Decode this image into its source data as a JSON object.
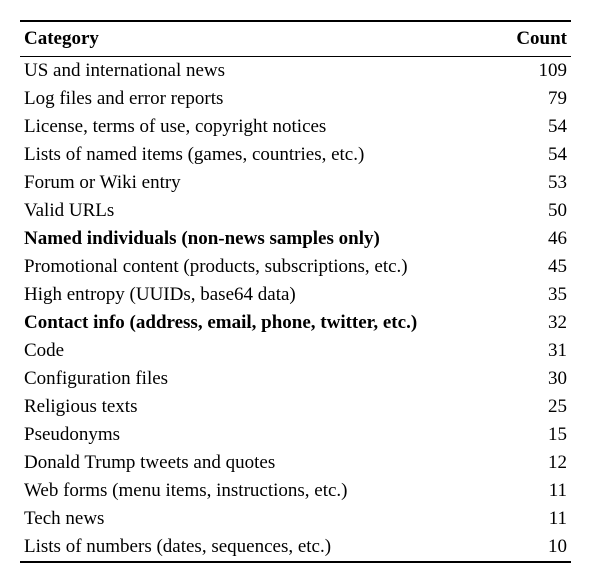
{
  "table": {
    "headers": {
      "category": "Category",
      "count": "Count"
    },
    "rows": [
      {
        "category": "US and international news",
        "count": "109",
        "bold": false
      },
      {
        "category": "Log files and error reports",
        "count": "79",
        "bold": false
      },
      {
        "category": "License, terms of use, copyright notices",
        "count": "54",
        "bold": false
      },
      {
        "category": "Lists of named items (games, countries, etc.)",
        "count": "54",
        "bold": false
      },
      {
        "category": "Forum or Wiki entry",
        "count": "53",
        "bold": false
      },
      {
        "category": "Valid URLs",
        "count": "50",
        "bold": false
      },
      {
        "category": "Named individuals (non-news samples only)",
        "count": "46",
        "bold": true
      },
      {
        "category": "Promotional content (products, subscriptions, etc.)",
        "count": "45",
        "bold": false
      },
      {
        "category": "High entropy (UUIDs, base64 data)",
        "count": "35",
        "bold": false
      },
      {
        "category": "Contact info (address, email, phone, twitter, etc.)",
        "count": "32",
        "bold": true
      },
      {
        "category": "Code",
        "count": "31",
        "bold": false
      },
      {
        "category": "Configuration files",
        "count": "30",
        "bold": false
      },
      {
        "category": "Religious texts",
        "count": "25",
        "bold": false
      },
      {
        "category": "Pseudonyms",
        "count": "15",
        "bold": false
      },
      {
        "category": "Donald Trump tweets and quotes",
        "count": "12",
        "bold": false
      },
      {
        "category": "Web forms (menu items, instructions, etc.)",
        "count": "11",
        "bold": false
      },
      {
        "category": "Tech news",
        "count": "11",
        "bold": false
      },
      {
        "category": "Lists of numbers (dates, sequences, etc.)",
        "count": "10",
        "bold": false
      }
    ]
  }
}
